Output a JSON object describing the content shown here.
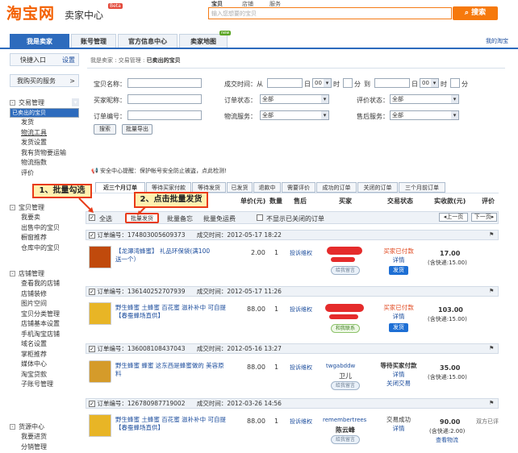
{
  "header": {
    "logo": "淘宝网",
    "logo_sub": "卖家中心",
    "beta": "Beta",
    "search_tabs": [
      "宝贝",
      "店铺",
      "服务"
    ],
    "search_placeholder": "输入您想要的宝贝",
    "search_button": "搜索"
  },
  "nav": {
    "tabs": [
      "我是卖家",
      "账号管理",
      "官方信息中心",
      "卖家地图"
    ],
    "new_badge": "new",
    "my_taobao": "我的淘宝"
  },
  "sidebar": {
    "quick_entry": "快捷入口",
    "settings": "设置",
    "purchased_service": "我购买的服务",
    "arrow": ">",
    "sections": [
      {
        "title": "交易管理",
        "items": [
          "已卖出的宝贝",
          "发货",
          "物流工具",
          "发货设置",
          "我有货物要运输",
          "物流指数",
          "评价"
        ]
      },
      {
        "title": "宝贝管理",
        "items": [
          "我要卖",
          "出售中的宝贝",
          "橱窗推荐",
          "仓库中的宝贝"
        ]
      },
      {
        "title": "店铺管理",
        "items": [
          "查看我的店铺",
          "店铺装修",
          "图片空间",
          "宝贝分类管理",
          "店铺基本设置",
          "手机淘宝店铺",
          "域名设置",
          "掌柜推荐",
          "媒体中心",
          "淘宝贷款",
          "子账号管理"
        ]
      },
      {
        "title": "货源中心",
        "items": [
          "我要进货",
          "分销管理"
        ]
      }
    ],
    "collapse_mark": "-"
  },
  "breadcrumb": {
    "prefix": "我是卖家 : 交易管理 : ",
    "current": "已卖出的宝贝"
  },
  "filters": {
    "item_name": "宝贝名称：",
    "deal_time": "成交时间：从",
    "to": "到",
    "day": "日",
    "hour": "时",
    "minute": "分",
    "hour_default": "00",
    "buyer_nick": "买家昵称：",
    "order_status": "订单状态：",
    "rate_status": "评价状态：",
    "order_no": "订单编号：",
    "logistics": "物流服务：",
    "after_sale": "售后服务：",
    "all": "全部",
    "search_btn": "搜索",
    "export_btn": "批量导出"
  },
  "safety_notice": "安全中心提醒：保护帐号安全防止被盗，点此检测!",
  "order_tabs": [
    "近三个月订单",
    "等待买家付款",
    "等待发货",
    "已发货",
    "退款中",
    "需要评价",
    "成功的订单",
    "关闭的订单",
    "三个月前订单"
  ],
  "table_header": [
    "宝贝",
    "单价(元)",
    "数量",
    "售后",
    "买家",
    "交易状态",
    "实收款(元)",
    "评价"
  ],
  "toolbar": {
    "select_all": "全选",
    "batch_ship": "批量发货",
    "batch_note": "批量备忘",
    "batch_free": "批量免运费",
    "hide_closed": "不显示已关闭的订单",
    "prev": "上一页",
    "next": "下一页"
  },
  "callouts": {
    "step1": "1、批量勾选",
    "step2": "2、点击批量发货"
  },
  "orders": [
    {
      "order_no": "订单编号：174803005609373",
      "deal_time": "成交时间：2012-05-17 18:22",
      "item": "【龙潭湾蜂蜜】 礼品环保袋(满100送一个）",
      "price": "2.00",
      "qty": "1",
      "after": "投诉维权",
      "buyer_btn": "给我留言",
      "status": "买家已付款",
      "detail": "详情",
      "action": "发货",
      "amount": "17.00",
      "shipping": "(含快递:15.00)",
      "rating": ""
    },
    {
      "order_no": "订单编号：136140252707939",
      "deal_time": "成交时间：2012-05-17 11:26",
      "item": "野生蜂蜜 土蜂蜜 百花蜜 滋补补中 可自提【春蚕蜂场直供】",
      "price": "88.00",
      "qty": "1",
      "after": "投诉维权",
      "buyer_btn": "和我联系",
      "status": "买家已付款",
      "detail": "详情",
      "action": "发货",
      "amount": "103.00",
      "shipping": "(含快递:15.00)",
      "rating": ""
    },
    {
      "order_no": "订单编号：136008108437043",
      "deal_time": "成交时间：2012-05-16 13:27",
      "item": "野生蜂蜜 蜂蜜 这东西是蜂蜜做的 美容原料",
      "price": "88.00",
      "qty": "1",
      "after": "投诉维权",
      "buyer_nick": "twgabddw",
      "buyer_name": "卫儿",
      "buyer_btn": "给我留言",
      "status": "等待买家付款",
      "detail": "详情",
      "action": "关闭交易",
      "amount": "35.00",
      "shipping": "(含快递:15.00)",
      "rating": ""
    },
    {
      "order_no": "订单编号：126780987719002",
      "deal_time": "成交时间：2012-03-26 14:56",
      "item": "野生蜂蜜 土蜂蜜 百花蜜 滋补补中 可自提【春蚕蜂场直供】",
      "price": "88.00",
      "qty": "1",
      "after": "投诉维权",
      "buyer_nick": "remembertrees",
      "buyer_name": "陈云峰",
      "buyer_btn": "给我留言",
      "status": "交易成功",
      "detail": "详情",
      "action": "",
      "amount": "90.00",
      "shipping": "(含快递:2.00)",
      "extra": "查看物流",
      "rating": "双方已评"
    }
  ]
}
